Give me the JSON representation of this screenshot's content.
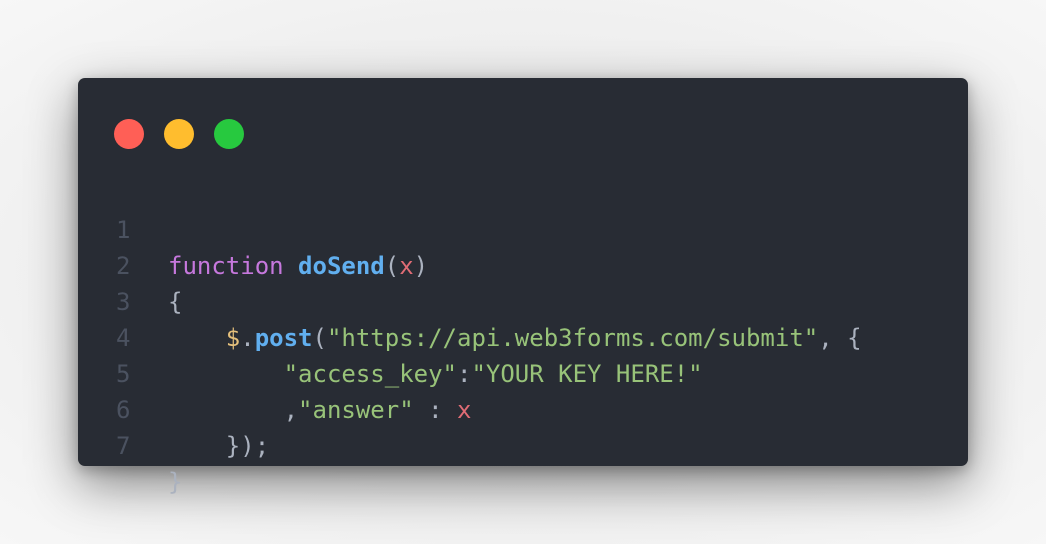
{
  "window": {
    "controls": [
      {
        "name": "close",
        "color": "#ff5f56"
      },
      {
        "name": "minimize",
        "color": "#ffbd2e"
      },
      {
        "name": "maximize",
        "color": "#27c93f"
      }
    ]
  },
  "code": {
    "line_numbers": [
      "1",
      "2",
      "3",
      "4",
      "5",
      "6",
      "7"
    ],
    "lines": {
      "l1": {
        "keyword": "function",
        "fn_name": "doSend",
        "open_paren": "(",
        "param": "x",
        "close_paren": ")"
      },
      "l2": {
        "text": "{"
      },
      "l3": {
        "indent": "    ",
        "dollar": "$",
        "dot": ".",
        "method": "post",
        "open_paren": "(",
        "url": "\"https://api.web3forms.com/submit\"",
        "rest": ", {"
      },
      "l4": {
        "indent": "        ",
        "key": "\"access_key\"",
        "colon": ":",
        "value": "\"YOUR KEY HERE!\""
      },
      "l5": {
        "indent": "        ",
        "comma": ",",
        "key": "\"answer\"",
        "colon": " : ",
        "value": "x"
      },
      "l6": {
        "indent": "    ",
        "text": "});"
      },
      "l7": {
        "text": "}"
      }
    }
  },
  "colors": {
    "background": "#282c34",
    "keyword": "#c678dd",
    "function": "#61afef",
    "string": "#98c379",
    "parameter": "#e06c75",
    "dollar": "#e5c07b",
    "line_number": "#4b5260"
  }
}
